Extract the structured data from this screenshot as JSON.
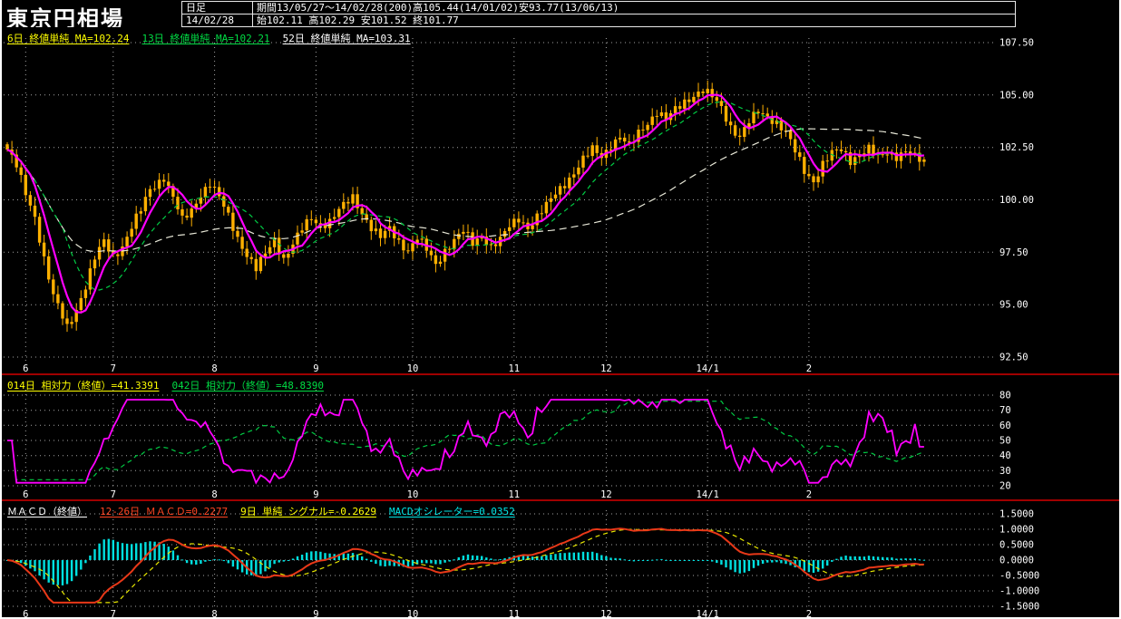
{
  "window": {
    "title": "東京円相場"
  },
  "header": {
    "timeframe": "日足",
    "period_text": "期間13/05/27～14/02/28(200)高105.44(14/01/02)安93.77(13/06/13)",
    "date": "14/02/28",
    "ohlc_text": "始102.11 高102.29 安101.52 終101.77"
  },
  "colors": {
    "background": "#000000",
    "candle": "#ffb000",
    "ma6": "#ff00ff",
    "ma13": "#00cc44",
    "ma52": "#e8e8d8",
    "rsi14": "#ff00ff",
    "rsi42": "#00cc44",
    "macd": "#e83818",
    "signal": "#e8e800",
    "histogram": "#00e0e0",
    "grid": "#b6b6b6",
    "separator": "#a00000",
    "axis_text": "#ffffff"
  },
  "price_panel": {
    "legend": [
      {
        "label": "6日 終値単純 MA=102.24",
        "color": "#ffff00"
      },
      {
        "label": "13日 終値単純 MA=102.21",
        "color": "#00dd44"
      },
      {
        "label": "52日 終値単純 MA=103.31",
        "color": "#ffffff"
      }
    ],
    "y_ticks": [
      {
        "v": 107.5,
        "label": "107.50"
      },
      {
        "v": 105.0,
        "label": "105.00"
      },
      {
        "v": 102.5,
        "label": "102.50"
      },
      {
        "v": 100.0,
        "label": "100.00"
      },
      {
        "v": 97.5,
        "label": "97.50"
      },
      {
        "v": 95.0,
        "label": "95.00"
      },
      {
        "v": 92.5,
        "label": "92.50"
      }
    ]
  },
  "rsi_panel": {
    "legend": [
      {
        "label": "014日 相対力（終値）=41.3391",
        "color": "#ffff00"
      },
      {
        "label": "042日 相対力（終値）=48.8390",
        "color": "#00dd44"
      }
    ],
    "y_ticks": [
      {
        "v": 80,
        "label": "80"
      },
      {
        "v": 70,
        "label": "70"
      },
      {
        "v": 60,
        "label": "60"
      },
      {
        "v": 50,
        "label": "50"
      },
      {
        "v": 40,
        "label": "40"
      },
      {
        "v": 30,
        "label": "30"
      },
      {
        "v": 20,
        "label": "20"
      }
    ]
  },
  "macd_panel": {
    "legend": [
      {
        "label": "ＭＡＣＤ（終値）",
        "color": "#ffffff"
      },
      {
        "label": "12-26日 ＭＡＣＤ=0.2277",
        "color": "#ff4422"
      },
      {
        "label": "9日 単純 シグナル=-0.2629",
        "color": "#ffff00"
      },
      {
        "label": "MACDオシレーター=0.0352",
        "color": "#00e5e5"
      }
    ],
    "y_ticks": [
      {
        "v": 1.5,
        "label": "1.5000"
      },
      {
        "v": 1.0,
        "label": "1.0000"
      },
      {
        "v": 0.5,
        "label": "0.5000"
      },
      {
        "v": 0.0,
        "label": "0.0000"
      },
      {
        "v": -0.5,
        "label": "-0.5000"
      },
      {
        "v": -1.0,
        "label": "-1.0000"
      },
      {
        "v": -1.5,
        "label": "-1.5000"
      }
    ]
  },
  "chart_data": {
    "type": "candlestick+indicators",
    "title": "東京円相場 日足",
    "period_label": "13/05/27～14/02/28 (200本)",
    "bars": 200,
    "high": {
      "value": 105.44,
      "date": "14/01/02"
    },
    "low": {
      "value": 93.77,
      "date": "13/06/13"
    },
    "last_bar": {
      "date": "14/02/28",
      "open": 102.11,
      "high": 102.29,
      "low": 101.52,
      "close": 101.77
    },
    "price_axis_range": [
      92.5,
      107.5
    ],
    "rsi_axis_range": [
      20,
      80
    ],
    "macd_axis_range": [
      -1.5,
      1.5
    ],
    "ma_periods": [
      6,
      13,
      52
    ],
    "ma_values": {
      "ma6": 102.24,
      "ma13": 102.21,
      "ma52": 103.31
    },
    "rsi_periods": [
      14,
      42
    ],
    "rsi_values": {
      "rsi14": 41.3391,
      "rsi42": 48.839
    },
    "macd": {
      "fast": 12,
      "slow": 26,
      "signal": 9
    },
    "macd_values": {
      "macd": 0.2277,
      "signal": -0.2629,
      "oscillator": 0.0352
    },
    "months": [
      {
        "label": "6",
        "bar": 4
      },
      {
        "label": "7",
        "bar": 23
      },
      {
        "label": "8",
        "bar": 45
      },
      {
        "label": "9",
        "bar": 67
      },
      {
        "label": "10",
        "bar": 88
      },
      {
        "label": "11",
        "bar": 110
      },
      {
        "label": "12",
        "bar": 130
      },
      {
        "label": "14/1",
        "bar": 152
      },
      {
        "label": "2",
        "bar": 174
      }
    ],
    "close_waypoints": [
      [
        0,
        102.4
      ],
      [
        2,
        101.6
      ],
      [
        4,
        100.3
      ],
      [
        6,
        99.2
      ],
      [
        8,
        97.2
      ],
      [
        10,
        95.4
      ],
      [
        12,
        94.4
      ],
      [
        13,
        93.9
      ],
      [
        15,
        94.8
      ],
      [
        17,
        95.9
      ],
      [
        19,
        97.2
      ],
      [
        21,
        98.0
      ],
      [
        23,
        97.3
      ],
      [
        25,
        97.8
      ],
      [
        27,
        98.7
      ],
      [
        29,
        99.5
      ],
      [
        31,
        100.5
      ],
      [
        34,
        101.1
      ],
      [
        36,
        100.1
      ],
      [
        38,
        99.0
      ],
      [
        40,
        99.5
      ],
      [
        42,
        100.3
      ],
      [
        44,
        100.8
      ],
      [
        46,
        100.1
      ],
      [
        48,
        99.2
      ],
      [
        50,
        98.2
      ],
      [
        52,
        97.4
      ],
      [
        54,
        96.7
      ],
      [
        56,
        97.4
      ],
      [
        58,
        98.1
      ],
      [
        60,
        97.2
      ],
      [
        62,
        97.9
      ],
      [
        64,
        98.6
      ],
      [
        66,
        99.1
      ],
      [
        68,
        98.8
      ],
      [
        70,
        99.0
      ],
      [
        72,
        99.5
      ],
      [
        75,
        100.1
      ],
      [
        77,
        99.4
      ],
      [
        79,
        98.7
      ],
      [
        81,
        98.2
      ],
      [
        83,
        98.6
      ],
      [
        85,
        98.0
      ],
      [
        87,
        97.6
      ],
      [
        89,
        98.2
      ],
      [
        91,
        97.6
      ],
      [
        93,
        96.9
      ],
      [
        95,
        97.6
      ],
      [
        97,
        98.1
      ],
      [
        99,
        98.5
      ],
      [
        101,
        97.9
      ],
      [
        103,
        98.3
      ],
      [
        105,
        97.8
      ],
      [
        107,
        98.1
      ],
      [
        109,
        98.7
      ],
      [
        111,
        99.1
      ],
      [
        113,
        98.7
      ],
      [
        115,
        99.2
      ],
      [
        117,
        99.7
      ],
      [
        119,
        100.3
      ],
      [
        121,
        100.8
      ],
      [
        123,
        101.3
      ],
      [
        125,
        101.9
      ],
      [
        127,
        102.4
      ],
      [
        129,
        102.1
      ],
      [
        131,
        102.6
      ],
      [
        133,
        103.0
      ],
      [
        135,
        102.5
      ],
      [
        137,
        103.2
      ],
      [
        139,
        103.7
      ],
      [
        141,
        104.2
      ],
      [
        143,
        103.8
      ],
      [
        145,
        104.3
      ],
      [
        147,
        104.7
      ],
      [
        149,
        105.0
      ],
      [
        151,
        105.2
      ],
      [
        153,
        104.9
      ],
      [
        155,
        104.4
      ],
      [
        157,
        103.5
      ],
      [
        159,
        103.0
      ],
      [
        161,
        103.7
      ],
      [
        163,
        104.2
      ],
      [
        165,
        104.0
      ],
      [
        167,
        103.7
      ],
      [
        169,
        103.2
      ],
      [
        171,
        102.3
      ],
      [
        173,
        101.4
      ],
      [
        175,
        100.9
      ],
      [
        177,
        101.7
      ],
      [
        179,
        102.2
      ],
      [
        181,
        102.4
      ],
      [
        183,
        101.9
      ],
      [
        185,
        102.2
      ],
      [
        187,
        102.4
      ],
      [
        189,
        102.0
      ],
      [
        191,
        102.3
      ],
      [
        193,
        102.1
      ],
      [
        195,
        102.3
      ],
      [
        197,
        102.0
      ],
      [
        199,
        101.8
      ]
    ]
  }
}
